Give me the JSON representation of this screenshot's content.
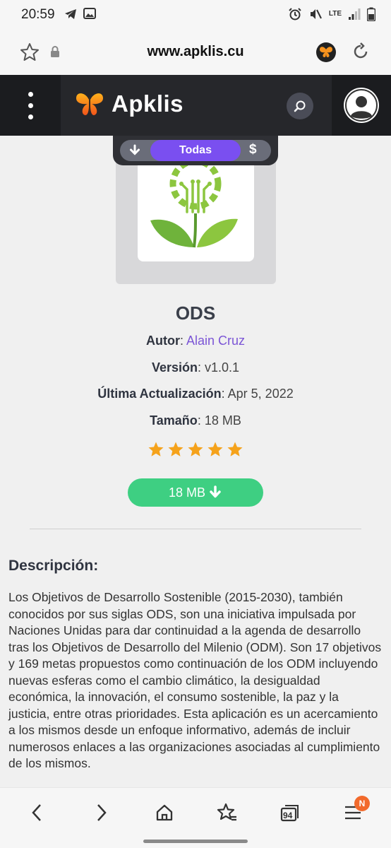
{
  "status_bar": {
    "time": "20:59",
    "network": "LTE"
  },
  "browser": {
    "url": "www.apklis.cu"
  },
  "header": {
    "brand": "Apklis"
  },
  "filters": {
    "active_label": "Todas",
    "paid_symbol": "$"
  },
  "app": {
    "name": "ODS",
    "author_label": "Autor",
    "author": "Alain Cruz",
    "version_label": "Versión",
    "version": "v1.0.1",
    "updated_label": "Última Actualización",
    "updated": "Apr 5, 2022",
    "size_label": "Tamaño",
    "size": "18 MB",
    "rating": 5,
    "download_label": "18 MB"
  },
  "description": {
    "title": "Descripción:",
    "text": "Los Objetivos de Desarrollo Sostenible (2015-2030), también conocidos por sus siglas ODS, son una iniciativa impulsada por Naciones Unidas para dar continuidad a la agenda de desarrollo tras los Objetivos de Desarrollo del Milenio (ODM). Son 17 objetivos y 169 metas propuestos como continuación de los ODM incluyendo nuevas esferas como el cambio climático, la desigualdad económica, la innovación, el consumo sostenible, la paz y la justicia, entre otras prioridades. Esta aplicación es un acercamiento a los mismos desde un enfoque informativo, además de incluir numerosos enlaces a las organizaciones asociadas al cumplimiento de los mismos."
  },
  "bottom_nav": {
    "tab_count": "94",
    "menu_badge": "N"
  },
  "colors": {
    "accent": "#7a4ff0",
    "download": "#3ecf82",
    "header": "#26272b",
    "star": "#f5a21b",
    "link": "#7b55d6"
  }
}
